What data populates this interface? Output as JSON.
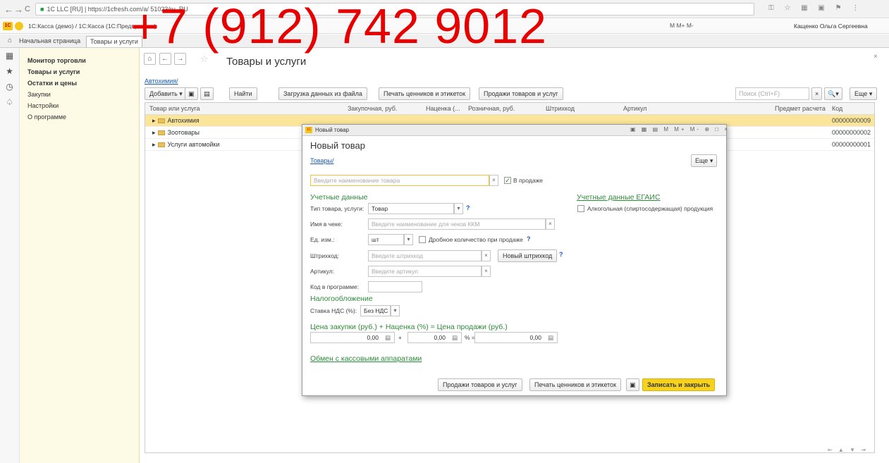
{
  "browser": {
    "url": "1C LLC [RU]  |  https://1cfresh.com/a/                  51023/ru_RU",
    "back": "←",
    "forward": "→",
    "reload": "C"
  },
  "app": {
    "title": "1С:Касса (демо) / 1С:Касса  (1С:Предприятие)",
    "toolbar_right": "M  M+  M-",
    "user": "Кащенко Ольга Сергеевна"
  },
  "tabs": [
    "Начальная страница",
    "Товары и услуги"
  ],
  "sections": [
    {
      "label": "Монитор торговли",
      "bold": true
    },
    {
      "label": "Товары и услуги",
      "bold": true
    },
    {
      "label": "Остатки и цены",
      "bold": true
    },
    {
      "label": "Закупки",
      "bold": false
    },
    {
      "label": "Настройки",
      "bold": false
    },
    {
      "label": "О программе",
      "bold": false
    }
  ],
  "form": {
    "title": "Товары и услуги",
    "breadcrumb": "Автохимия/",
    "toolbar": {
      "add": "Добавить",
      "find": "Найти",
      "load": "Загрузка данных из файла",
      "print": "Печать ценников и этикеток",
      "sales": "Продажи товаров и услуг",
      "search_placeholder": "Поиск (Ctrl+F)",
      "more": "Еще"
    },
    "columns": [
      "Товар или услуга",
      "Закупочная, руб.",
      "Наценка (...",
      "Розничная, руб.",
      "Штрихкод",
      "Артикул",
      "Предмет расчета",
      "Код"
    ],
    "rows": [
      {
        "name": "Автохимия",
        "code": "00000000009",
        "selected": true
      },
      {
        "name": "Зоотовары",
        "code": "00000000002",
        "selected": false
      },
      {
        "name": "Услуги автомойки",
        "code": "00000000001",
        "selected": false
      }
    ]
  },
  "dialog": {
    "window_title": "Новый товар",
    "heading": "Новый товар",
    "breadcrumb": "Товары/",
    "more": "Еще",
    "name_placeholder": "Введите наименование товара",
    "on_sale_label": "В продаже",
    "on_sale_checked": true,
    "accounting_header": "Учетные данные",
    "egais_header": "Учетные данные ЕГАИС",
    "egais_alcohol_label": "Алкогольная (спиртосодержащая) продукция",
    "type_label": "Тип товара, услуги:",
    "type_value": "Товар",
    "receipt_name_label": "Имя в чеке:",
    "receipt_name_placeholder": "Введите наименование для чеков ККМ",
    "unit_label": "Ед. изм.:",
    "unit_value": "шт",
    "fractional_label": "Дробное количество при продаже",
    "barcode_label": "Штрихкод:",
    "barcode_placeholder": "Введите штрихкод",
    "new_barcode_button": "Новый штрихкод",
    "article_label": "Артикул:",
    "article_placeholder": "Введите артикул",
    "program_code_label": "Код в программе:",
    "tax_header": "Налогообложение",
    "vat_label": "Ставка НДС (%):",
    "vat_value": "Без НДС",
    "price_header": "Цена закупки (руб.) + Наценка (%) = Цена продажи (руб.)",
    "purchase_price": "0,00",
    "markup": "0,00",
    "sale_price": "0,00",
    "plus": "+",
    "percent_eq": "%  =",
    "exchange_link": "Обмен с кассовыми аппаратами",
    "btn_sales": "Продажи товаров и услуг",
    "btn_print": "Печать ценников и этикеток",
    "btn_save_close": "Записать и закрыть"
  },
  "watermark": "+7 (912) 742 9012"
}
